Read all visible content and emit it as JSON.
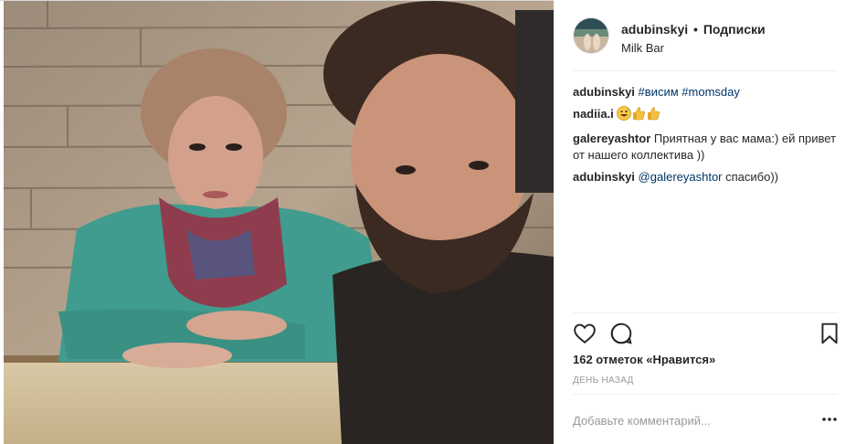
{
  "post": {
    "author": "adubinskyi",
    "separator": "•",
    "follow_status": "Подписки",
    "location": "Milk Bar"
  },
  "comments": [
    {
      "user": "adubinskyi",
      "text_parts": [
        {
          "kind": "tag",
          "text": "#висим"
        },
        {
          "kind": "text",
          "text": " "
        },
        {
          "kind": "tag",
          "text": "#momsday"
        }
      ]
    },
    {
      "user": "nadiia.i",
      "emoji": [
        "grinning-sweat-emoji",
        "thumbs-up-emoji",
        "thumbs-up-emoji"
      ]
    },
    {
      "user": "galereyashtor",
      "text": "Приятная у вас мама:) ей привет от нашего коллектива ))"
    },
    {
      "user": "adubinskyi",
      "mention": "@galereyashtor",
      "text": " спасибо))"
    }
  ],
  "stats": {
    "likes": "162 отметок «Нравится»",
    "time_ago": "ДЕНЬ НАЗАД"
  },
  "comment_box": {
    "placeholder": "Добавьте комментарий..."
  },
  "icons": {
    "like": "heart-outline-icon",
    "comment": "speech-bubble-icon",
    "save": "bookmark-icon",
    "more": "ellipsis-icon"
  }
}
